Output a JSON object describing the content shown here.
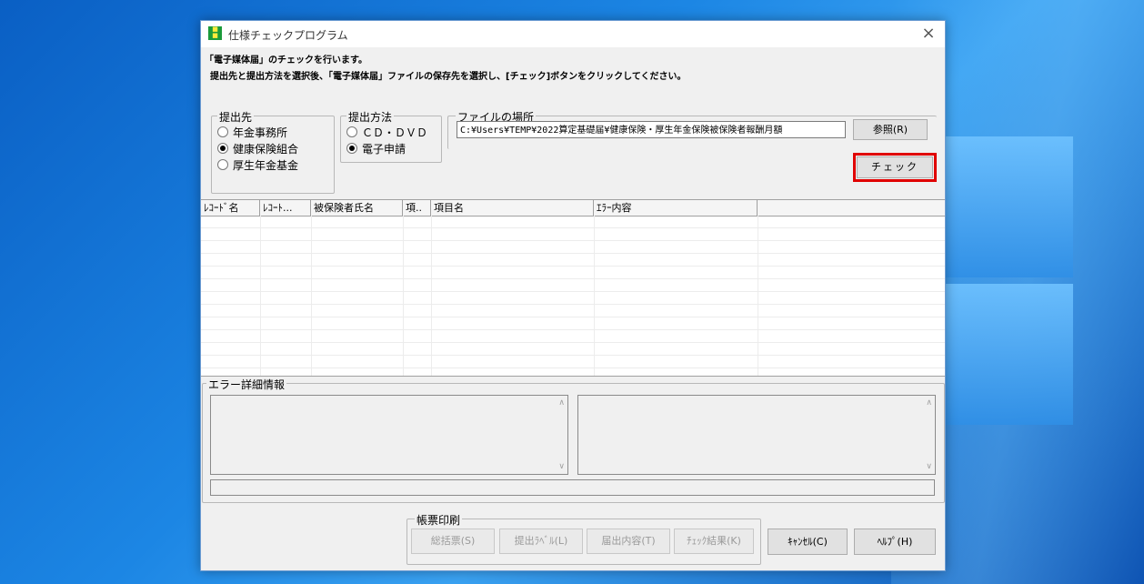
{
  "window": {
    "title": "仕様チェックプログラム",
    "icon_name": "app-icon",
    "close_glyph": "×"
  },
  "instructions": {
    "line1": "「電子媒体届」のチェックを行います。",
    "line2": "提出先と提出方法を選択後、「電子媒体届」ファイルの保存先を選択し、[チェック]ボタンをクリックしてください。"
  },
  "destination": {
    "label": "提出先",
    "options": [
      {
        "label": "年金事務所",
        "checked": false
      },
      {
        "label": "健康保険組合",
        "checked": true
      },
      {
        "label": "厚生年金基金",
        "checked": false
      }
    ]
  },
  "method": {
    "label": "提出方法",
    "options": [
      {
        "label": "ＣＤ・ＤＶＤ",
        "checked": false
      },
      {
        "label": "電子申請",
        "checked": true
      }
    ]
  },
  "file_location": {
    "label": "ファイルの場所",
    "path": "C:¥Users¥TEMP¥2022算定基礎届¥健康保険・厚生年金保険被保険者報酬月額",
    "browse_label": "参照(R)"
  },
  "check_button": {
    "label": "チェック"
  },
  "grid": {
    "columns": [
      "ﾚｺｰﾄﾞ名",
      "ﾚｺｰﾄ...",
      "被保険者氏名",
      "項..",
      "項目名",
      "ｴﾗｰ内容",
      ""
    ]
  },
  "error_detail": {
    "label": "エラー詳細情報"
  },
  "print": {
    "label": "帳票印刷",
    "buttons": [
      "総括票(S)",
      "提出ﾗﾍﾞﾙ(L)",
      "届出内容(T)",
      "ﾁｪｯｸ結果(K)"
    ]
  },
  "footer": {
    "cancel_label": "ｷｬﾝｾﾙ(C)",
    "help_label": "ﾍﾙﾌﾟ(H)"
  },
  "colors": {
    "highlight": "#e00000",
    "desktop": "#1c86e4",
    "window_bg": "#f0f0f0"
  }
}
